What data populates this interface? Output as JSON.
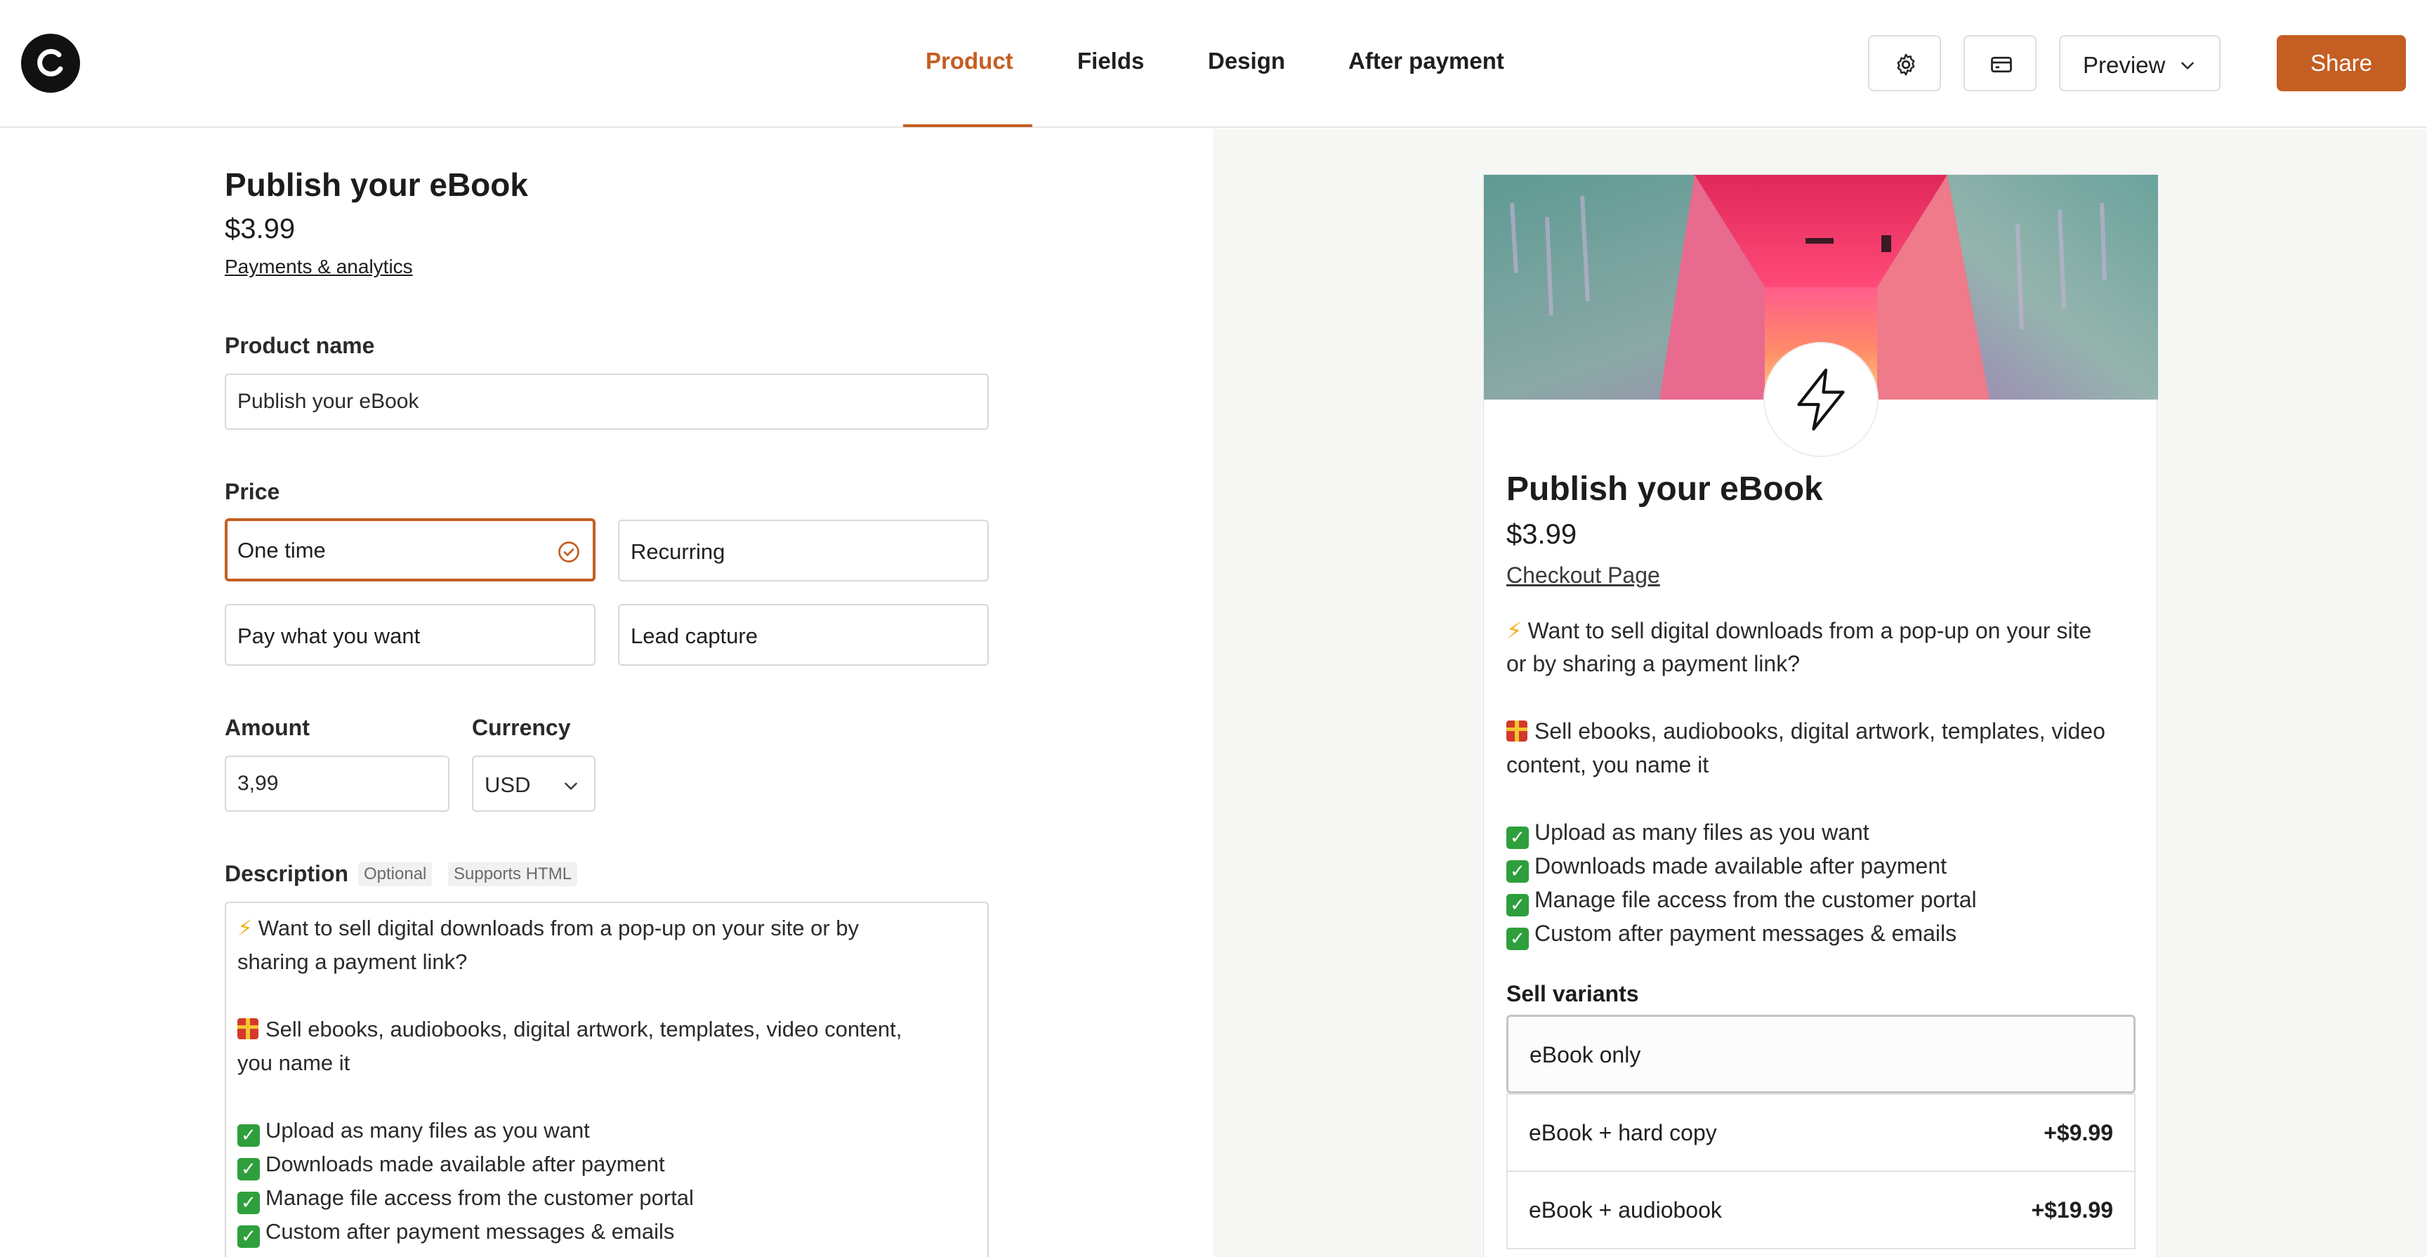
{
  "nav": {
    "tabs": [
      {
        "label": "Product",
        "active": true
      },
      {
        "label": "Fields",
        "active": false
      },
      {
        "label": "Design",
        "active": false
      },
      {
        "label": "After payment",
        "active": false
      }
    ],
    "preview_label": "Preview",
    "share_label": "Share",
    "accent_color": "#c45e22"
  },
  "form": {
    "title": "Publish your eBook",
    "price": "$3.99",
    "payments_link": "Payments & analytics",
    "product_name_label": "Product name",
    "product_name_value": "Publish your eBook",
    "price_label": "Price",
    "price_options": [
      "One time",
      "Recurring",
      "Pay what you want",
      "Lead capture"
    ],
    "selected_price_option": "One time",
    "amount_label": "Amount",
    "amount_value": "3,99",
    "currency_label": "Currency",
    "currency_value": "USD",
    "description_label": "Description",
    "badge_optional": "Optional",
    "badge_html": "Supports HTML",
    "description_lines": [
      "Want to sell digital downloads from a pop-up on your site or by",
      "sharing a payment link?",
      "Sell ebooks, audiobooks, digital artwork, templates, video content,",
      "you name it",
      "Upload as many files as you want",
      "Downloads made available after payment",
      "Manage file access from the customer portal",
      "Custom after payment messages & emails"
    ]
  },
  "preview": {
    "title": "Publish your eBook",
    "price": "$3.99",
    "link": "Checkout Page",
    "lines": [
      "Want to sell digital downloads from a pop-up on your site",
      "or by sharing a payment link?",
      "Sell ebooks, audiobooks, digital artwork, templates, video",
      "content, you name it",
      "Upload as many files as you want",
      "Downloads made available after payment",
      "Manage file access from the customer portal",
      "Custom after payment messages & emails"
    ],
    "variants_label": "Sell variants",
    "variants": [
      {
        "label": "eBook only",
        "price": ""
      },
      {
        "label": "eBook + hard copy",
        "price": "+$9.99"
      },
      {
        "label": "eBook + audiobook",
        "price": "+$19.99"
      }
    ]
  }
}
